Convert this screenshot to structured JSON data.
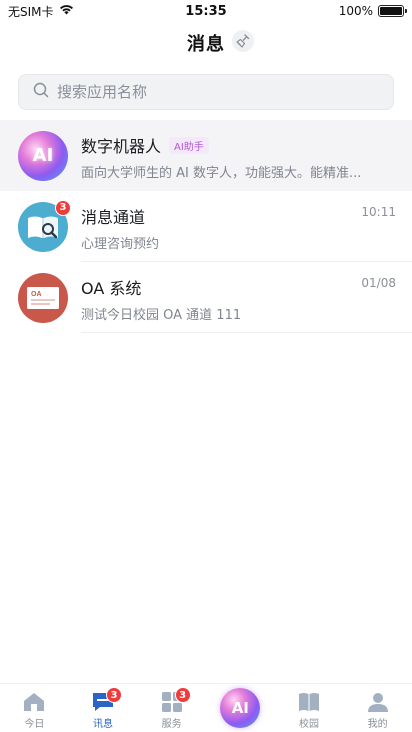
{
  "status_bar": {
    "carrier": "无SIM卡",
    "time": "15:35",
    "battery": "100%",
    "battery_level": 1.0
  },
  "header": {
    "title": "消息",
    "clear_icon": "broom-icon"
  },
  "search": {
    "placeholder": "搜索应用名称",
    "icon": "search-icon"
  },
  "messages": [
    {
      "title": "数字机器人",
      "tag": "AI助手",
      "subtitle": "面向大学师生的 AI 数字人，功能强大。能精准...",
      "time": "",
      "badge": "",
      "avatar_text": "AI"
    },
    {
      "title": "消息通道",
      "tag": "",
      "subtitle": "心理咨询预约",
      "time": "10:11",
      "badge": "3",
      "avatar_text": ""
    },
    {
      "title": "OA 系统",
      "tag": "",
      "subtitle": "测试今日校园 OA 通道 111",
      "time": "01/08",
      "badge": "",
      "avatar_text": "OA"
    }
  ],
  "tab_bar": {
    "tabs": [
      {
        "label": "今日",
        "icon": "home-icon",
        "badge": ""
      },
      {
        "label": "讯息",
        "icon": "chat-icon",
        "badge": "3"
      },
      {
        "label": "服务",
        "icon": "grid-icon",
        "badge": "3"
      },
      {
        "label": "",
        "icon": "ai-orb-icon",
        "badge": "",
        "text": "AI"
      },
      {
        "label": "校园",
        "icon": "book-icon",
        "badge": ""
      },
      {
        "label": "我的",
        "icon": "user-icon",
        "badge": ""
      }
    ],
    "active_index": 1
  },
  "colors": {
    "accent": "#2a64c6",
    "badge": "#ee3b3b",
    "ai_tag": "#b35ad1"
  }
}
